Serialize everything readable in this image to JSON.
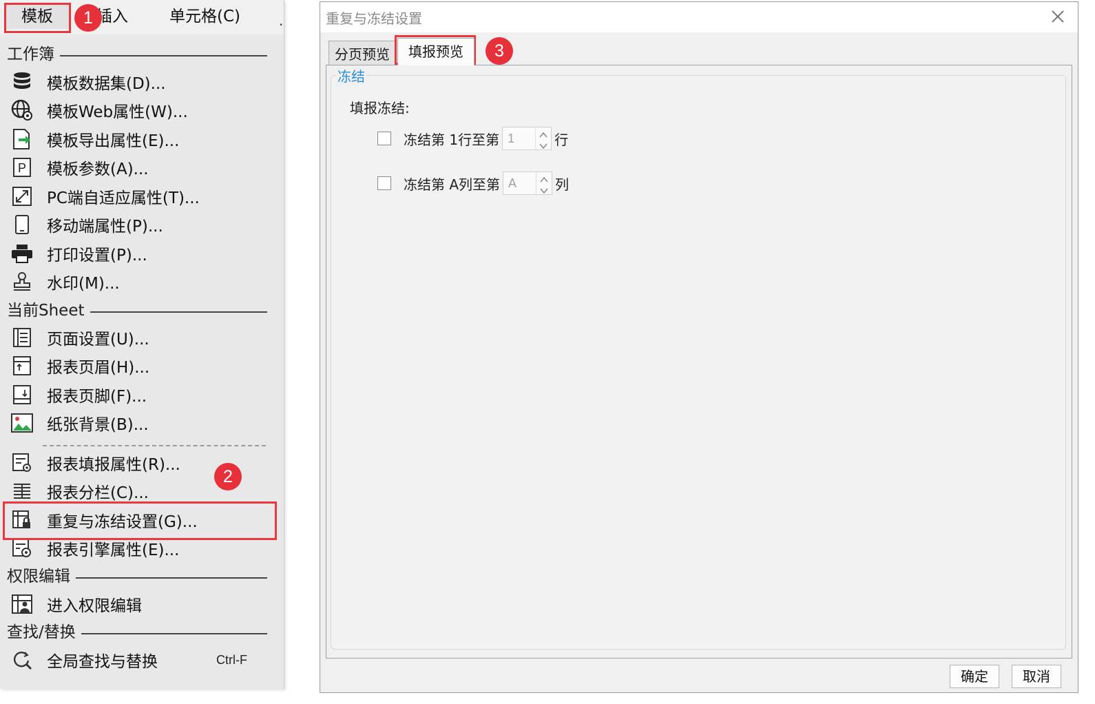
{
  "menubar": {
    "items": [
      {
        "label": "模板"
      },
      {
        "label": "插入"
      },
      {
        "label": "单元格(C)"
      }
    ],
    "overflow": "."
  },
  "badges": [
    "1",
    "2",
    "3"
  ],
  "menu": {
    "sections": [
      {
        "title": "工作簿"
      },
      {
        "title": "当前Sheet"
      },
      {
        "title": "权限编辑"
      },
      {
        "title": "查找/替换"
      }
    ],
    "items": [
      {
        "label": "模板数据集(D)...",
        "icon": "database-icon"
      },
      {
        "label": "模板Web属性(W)...",
        "icon": "web-globe-icon"
      },
      {
        "label": "模板导出属性(E)...",
        "icon": "export-icon"
      },
      {
        "label": "模板参数(A)...",
        "icon": "parameter-p-icon"
      },
      {
        "label": "PC端自适应属性(T)...",
        "icon": "expand-arrows-icon"
      },
      {
        "label": "移动端属性(P)...",
        "icon": "mobile-phone-icon"
      },
      {
        "label": "打印设置(P)...",
        "icon": "printer-icon"
      },
      {
        "label": "水印(M)...",
        "icon": "stamp-icon"
      },
      {
        "label": "页面设置(U)...",
        "icon": "page-layout-icon"
      },
      {
        "label": "报表页眉(H)...",
        "icon": "page-header-icon"
      },
      {
        "label": "报表页脚(F)...",
        "icon": "page-footer-icon"
      },
      {
        "label": "纸张背景(B)...",
        "icon": "image-background-icon"
      },
      {
        "label": "报表填报属性(R)...",
        "icon": "form-settings-icon"
      },
      {
        "label": "报表分栏(C)...",
        "icon": "columns-icon"
      },
      {
        "label": "重复与冻结设置(G)...",
        "icon": "freeze-lock-icon"
      },
      {
        "label": "报表引擎属性(E)...",
        "icon": "engine-settings-icon"
      },
      {
        "label": "进入权限编辑",
        "icon": "permission-user-icon"
      },
      {
        "label": "全局查找与替换",
        "icon": "search-replace-icon",
        "shortcut": "Ctrl-F"
      }
    ]
  },
  "dialog": {
    "title": "重复与冻结设置",
    "tabs": [
      {
        "label": "分页预览"
      },
      {
        "label": "填报预览"
      }
    ],
    "group_title": "冻结",
    "fill_freeze_label": "填报冻结:",
    "row_freeze": {
      "prefix": "冻结第 1行至第",
      "value": "1",
      "suffix": "行"
    },
    "col_freeze": {
      "prefix": "冻结第 A列至第",
      "value": "A",
      "suffix": "列"
    },
    "ok_label": "确定",
    "cancel_label": "取消"
  },
  "colors": {
    "highlight": "#e8383d",
    "badge": "#e6303a",
    "group_title": "#2a8fd6"
  }
}
